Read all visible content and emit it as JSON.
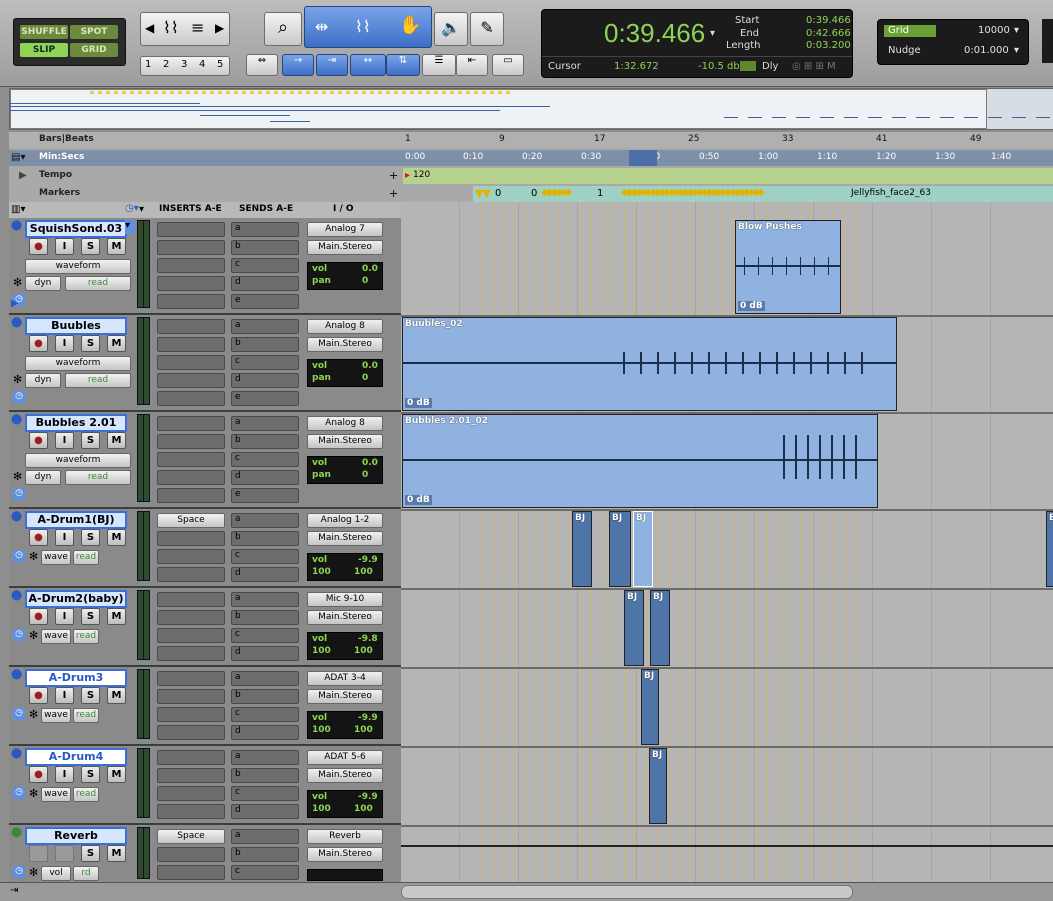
{
  "toolbar": {
    "modes": {
      "shuffle": "SHUFFLE",
      "spot": "SPOT",
      "slip": "SLIP",
      "grid": "GRID"
    },
    "zoom_presets": [
      "1",
      "2",
      "3",
      "4",
      "5"
    ],
    "main_counter": "0:39.466",
    "start_label": "Start",
    "start_value": "0:39.466",
    "end_label": "End",
    "end_value": "0:42.666",
    "length_label": "Length",
    "length_value": "0:03.200",
    "cursor_label": "Cursor",
    "cursor_value": "1:32.672",
    "cursor_db": "-10.5 db",
    "dly_label": "Dly",
    "grid_label": "Grid",
    "grid_value": "10000",
    "nudge_label": "Nudge",
    "nudge_value": "0:01.000"
  },
  "rulers": {
    "bars_label": "Bars|Beats",
    "minsecs_label": "Min:Secs",
    "tempo_label": "Tempo",
    "markers_label": "Markers",
    "bars_ticks": [
      "1",
      "9",
      "17",
      "25",
      "33",
      "41",
      "49"
    ],
    "time_ticks": [
      "0:00",
      "0:10",
      "0:20",
      "0:30",
      "0:40",
      "0:50",
      "1:00",
      "1:10",
      "1:20",
      "1:30",
      "1:40"
    ],
    "tempo_value": "120",
    "marker_text": "Jellyfish_face2_63",
    "marker_nums": [
      "0",
      "0",
      "1"
    ]
  },
  "columns": {
    "inserts": "INSERTS A-E",
    "sends": "SENDS A-E",
    "io": "I / O"
  },
  "rec_labels": {
    "i": "I",
    "s": "S",
    "m": "M"
  },
  "send_letters": [
    "a",
    "b",
    "c",
    "d",
    "e"
  ],
  "tracks": [
    {
      "name": "SquishSond.03",
      "view": "waveform",
      "auto": "dyn",
      "mode": "read",
      "input": "Analog 7",
      "output": "Main.Stereo",
      "vol": "0.0",
      "pan_label": "pan",
      "pan": "0",
      "insert": "",
      "clip": "Blow Pushes",
      "gain": "0 dB"
    },
    {
      "name": "Buubles",
      "view": "waveform",
      "auto": "dyn",
      "mode": "read",
      "input": "Analog 8",
      "output": "Main.Stereo",
      "vol": "0.0",
      "pan_label": "pan",
      "pan": "0",
      "insert": "",
      "clip": "Buubles_02",
      "gain": "0 dB"
    },
    {
      "name": "Bubbles 2.01",
      "view": "waveform",
      "auto": "dyn",
      "mode": "read",
      "input": "Analog 8",
      "output": "Main.Stereo",
      "vol": "0.0",
      "pan_label": "pan",
      "pan": "0",
      "insert": "",
      "clip": "Bubbles 2.01_02",
      "gain": "0 dB"
    },
    {
      "name": "A-Drum1(BJ)",
      "view": "wave",
      "mode": "read",
      "input": "Analog 1-2",
      "output": "Main.Stereo",
      "vol": "-9.9",
      "pan_l": "100",
      "pan_r": "100",
      "insert": "Space",
      "clip": "BJ"
    },
    {
      "name": "A-Drum2(baby)",
      "view": "wave",
      "mode": "read",
      "input": "Mic 9-10",
      "output": "Main.Stereo",
      "vol": "-9.8",
      "pan_l": "100",
      "pan_r": "100",
      "insert": "",
      "clip": "BJ"
    },
    {
      "name": "A-Drum3",
      "view": "wave",
      "mode": "read",
      "input": "ADAT 3-4",
      "output": "Main.Stereo",
      "vol": "-9.9",
      "pan_l": "100",
      "pan_r": "100",
      "insert": "",
      "clip": "BJ"
    },
    {
      "name": "A-Drum4",
      "view": "wave",
      "mode": "read",
      "input": "ADAT 5-6",
      "output": "Main.Stereo",
      "vol": "-9.9",
      "pan_l": "100",
      "pan_r": "100",
      "insert": "",
      "clip": "BJ"
    },
    {
      "name": "Reverb",
      "view": "vol",
      "mode": "rd",
      "input": "Reverb",
      "output": "Main.Stereo",
      "vol": "",
      "insert": "Space"
    }
  ],
  "colors": {
    "clip": "#8fb2e0",
    "track_name_border": "#3a6ed8",
    "counter_text": "#8fd454",
    "yellow_lines": "#e5b84c"
  }
}
